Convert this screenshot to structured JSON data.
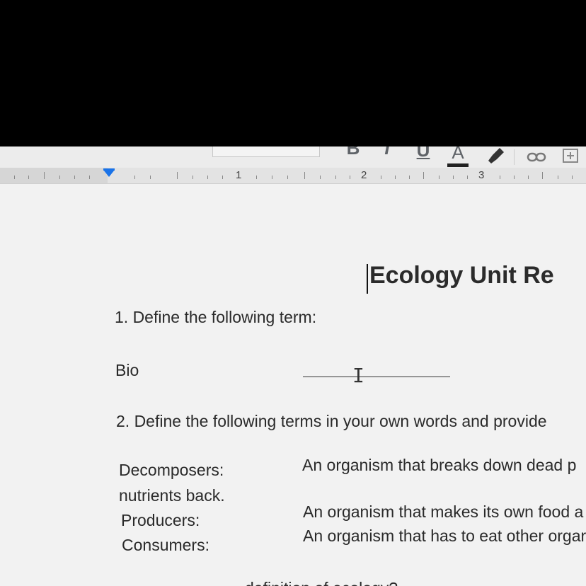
{
  "toolbar": {
    "bold": "B",
    "italic": "I",
    "underline": "U",
    "text_color": "A",
    "text_color_value": "#222222",
    "link_icon": "link-icon",
    "comment_icon": "add-comment-icon",
    "highlight_icon": "highlighter-icon"
  },
  "ruler": {
    "n1": "1",
    "n2": "2",
    "n3": "3"
  },
  "doc": {
    "title": "Ecology Unit Re",
    "q1": "1. Define the following term:",
    "bio_label": "Bio",
    "q2": "2. Define the following terms in your own words and provide",
    "decomposers_label": "Decomposers:",
    "decomposers_def": "An organism that breaks down dead p",
    "nutrients_back": "nutrients back.",
    "producers_label": "Producers:",
    "producers_def": "An organism that makes its own food a",
    "consumers_label": "Consumers:",
    "consumers_def": "An organism that has to eat other orgar",
    "q3_partial": "definition of ecology?"
  }
}
